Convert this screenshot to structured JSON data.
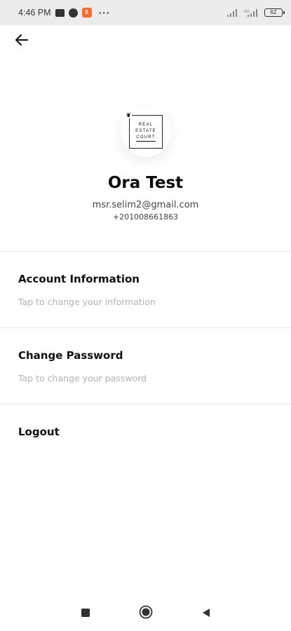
{
  "status_bar": {
    "time": "4:46 PM",
    "notification_icons": [
      "message-icon",
      "whatsapp-icon",
      "app-notification-icon"
    ],
    "more": "···",
    "battery_level": "62",
    "signal_icons": [
      "signal-icon",
      "signal-icon"
    ]
  },
  "header": {
    "back_icon": "arrow-left-icon"
  },
  "profile": {
    "logo_lines": [
      "REAL",
      "ESTATE",
      "COURT"
    ],
    "name": "Ora Test",
    "email": "msr.selim2@gmail.com",
    "phone": "+201008661863"
  },
  "menu": {
    "account": {
      "title": "Account Information",
      "subtitle": "Tap to change your information"
    },
    "password": {
      "title": "Change Password",
      "subtitle": "Tap to change your password"
    },
    "logout": {
      "title": "Logout"
    }
  },
  "nav_bar": {
    "icons": [
      "square-icon",
      "circle-icon",
      "triangle-back-icon"
    ]
  },
  "colors": {
    "status_bar_bg": "#ececec",
    "notif_accent": "#ff6a2b",
    "subtitle": "#b3b3b3",
    "divider": "#e6e6e6"
  }
}
